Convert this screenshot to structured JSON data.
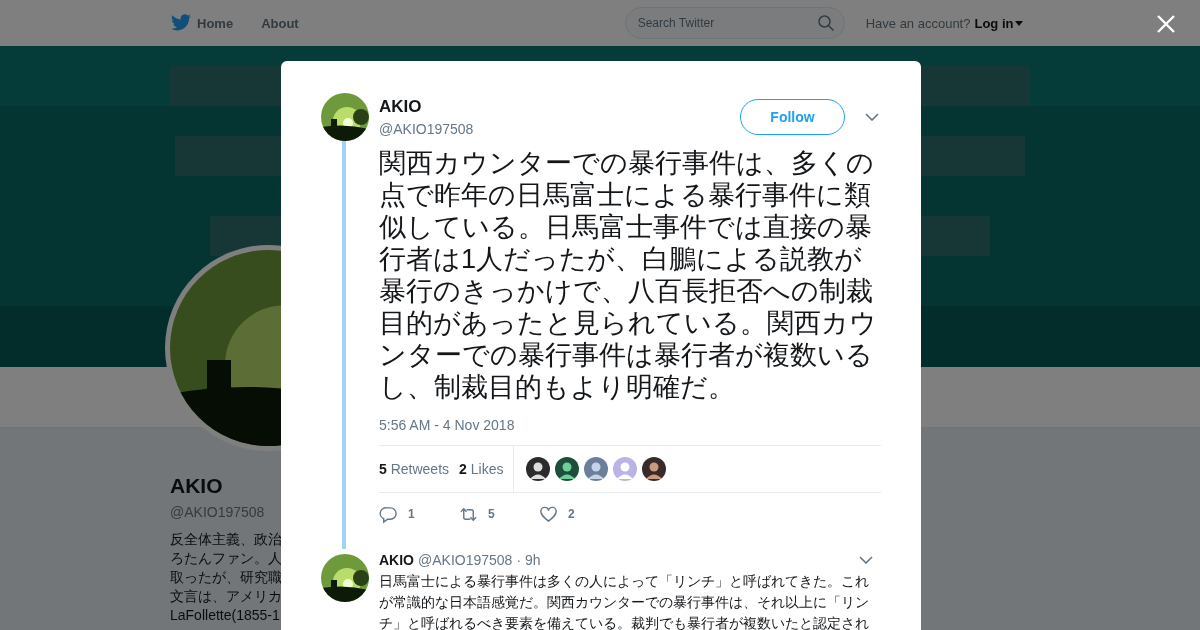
{
  "nav": {
    "links": [
      "Home",
      "About"
    ],
    "search": {
      "placeholder": "Search Twitter"
    },
    "account_prompt": "Have an account?",
    "login": "Log in"
  },
  "profile": {
    "name": "AKIO",
    "handle": "@AKIO197508",
    "bio_lines": [
      "反全体主義、政治",
      "ろたんファン。人",
      "取ったが、研究職",
      "文言は、アメリカ",
      "LaFollette(1855-1"
    ]
  },
  "tweet": {
    "name": "AKIO",
    "handle": "@AKIO197508",
    "follow": "Follow",
    "text": "関西カウンターでの暴行事件は、多くの点で昨年の日馬富士による暴行事件に類似している。日馬富士事件では直接の暴行者は1人だったが、白鵬による説教が暴行のきっかけで、八百長拒否への制裁目的があったと見られている。関西カウンターでの暴行事件は暴行者が複数いるし、制裁目的もより明確だ。",
    "timestamp": "5:56 AM - 4 Nov 2018",
    "stats": [
      {
        "count": "5",
        "label": "Retweets"
      },
      {
        "count": "2",
        "label": "Likes"
      }
    ],
    "actions": [
      {
        "kind": "reply",
        "count": "1"
      },
      {
        "kind": "retweet",
        "count": "5"
      },
      {
        "kind": "like",
        "count": "2"
      }
    ]
  },
  "reply": {
    "name": "AKIO",
    "handle": "@AKIO197508",
    "time": "· 9h",
    "text": "日馬富士による暴行事件は多くの人によって「リンチ」と呼ばれてきた。これが常識的な日本語感覚だ。関西カウンターでの暴行事件は、それ以上に「リンチ」と呼ばれるべき要素を備えている。裁判でも暴行者が複数いたと認定され"
  }
}
